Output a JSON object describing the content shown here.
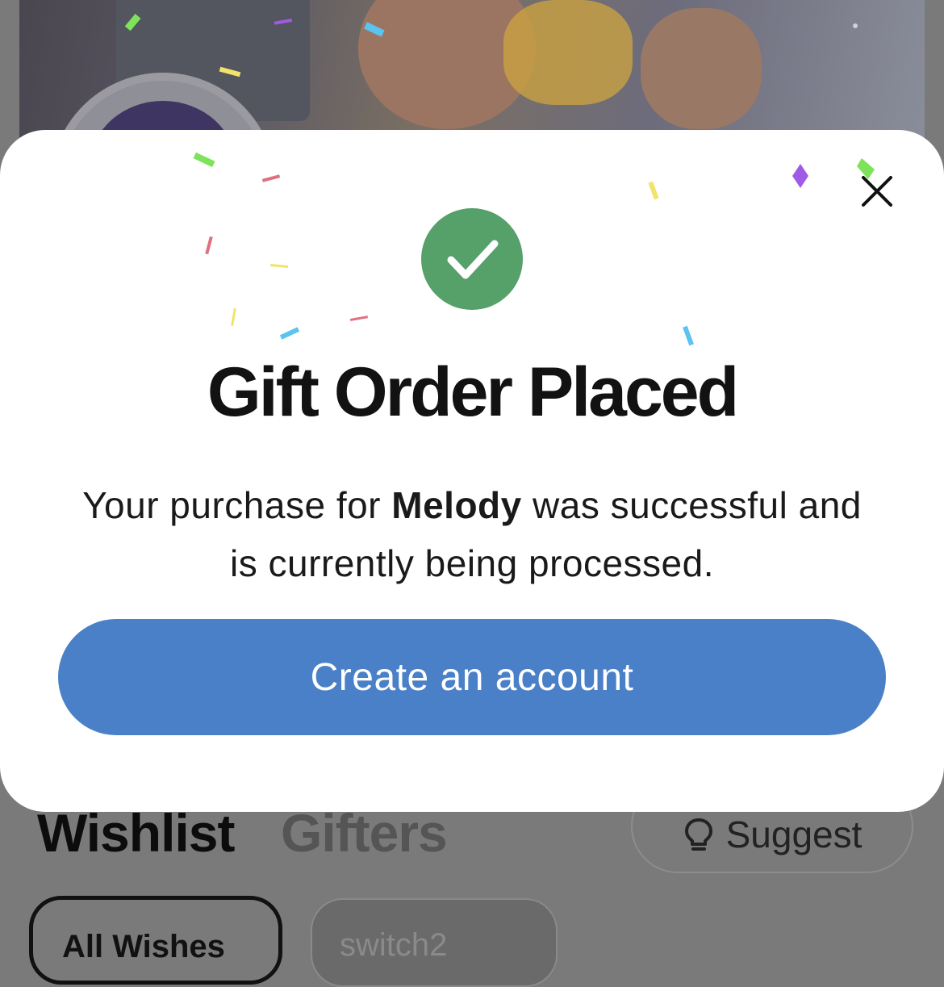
{
  "background": {
    "tabs": {
      "wishlist": "Wishlist",
      "gifters": "Gifters"
    },
    "suggest_label": "Suggest",
    "suggest_icon": "lightbulb-icon",
    "filters": {
      "all_wishes": "All Wishes",
      "switch": "switch2"
    }
  },
  "modal": {
    "status_icon": "check-circle-icon",
    "close_icon": "close-icon",
    "title": "Gift Order Placed",
    "message_before": "Your purchase for ",
    "recipient": "Melody",
    "message_after": " was successful and is currently being processed.",
    "cta_label": "Create an account"
  },
  "colors": {
    "success": "#56a06a",
    "primary": "#4a80c7",
    "confetti": [
      "#7ee35b",
      "#5bc3f0",
      "#f2e36b",
      "#a05be6",
      "#e0707e"
    ]
  }
}
